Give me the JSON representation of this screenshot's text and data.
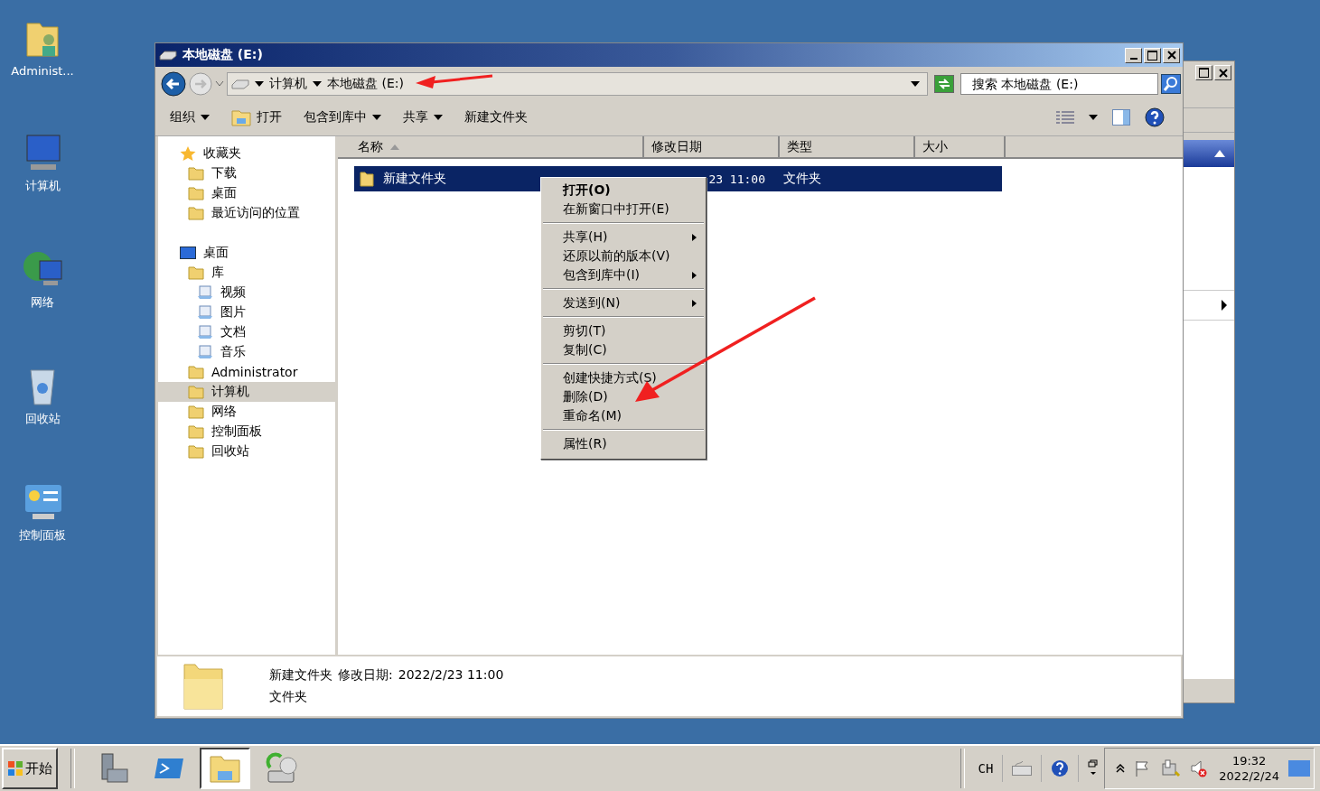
{
  "desktop_icons": [
    {
      "label": "Administ..."
    },
    {
      "label": "计算机"
    },
    {
      "label": "网络"
    },
    {
      "label": "回收站"
    },
    {
      "label": "控制面板"
    }
  ],
  "window": {
    "title": "本地磁盘 (E:)",
    "address": [
      "计算机",
      "本地磁盘 (E:)"
    ],
    "search": {
      "placeholder": "搜索 本地磁盘 (E:)"
    },
    "toolbar": [
      {
        "label": "组织",
        "dropdown": true,
        "icon": false
      },
      {
        "label": "打开",
        "dropdown": false,
        "icon": true
      },
      {
        "label": "包含到库中",
        "dropdown": true,
        "icon": false
      },
      {
        "label": "共享",
        "dropdown": true,
        "icon": false
      },
      {
        "label": "新建文件夹",
        "dropdown": false,
        "icon": false
      }
    ],
    "nav": [
      {
        "label": "收藏夹",
        "selected": false,
        "children": [
          {
            "label": "下载",
            "selected": false
          },
          {
            "label": "桌面",
            "selected": false
          },
          {
            "label": "最近访问的位置",
            "selected": false
          }
        ]
      },
      {
        "label": "桌面",
        "selected": false,
        "children": [
          {
            "label": "库",
            "selected": false,
            "children": [
              {
                "label": "视频",
                "selected": false
              },
              {
                "label": "图片",
                "selected": false
              },
              {
                "label": "文档",
                "selected": false
              },
              {
                "label": "音乐",
                "selected": false
              }
            ]
          },
          {
            "label": "Administrator",
            "selected": false
          },
          {
            "label": "计算机",
            "selected": true
          },
          {
            "label": "网络",
            "selected": false
          },
          {
            "label": "控制面板",
            "selected": false
          },
          {
            "label": "回收站",
            "selected": false
          }
        ]
      }
    ],
    "columns": [
      {
        "label": "名称",
        "sorted": true
      },
      {
        "label": "修改日期",
        "sorted": false
      },
      {
        "label": "类型",
        "sorted": false
      },
      {
        "label": "大小",
        "sorted": false
      }
    ],
    "files": [
      {
        "name": "新建文件夹",
        "date": "23 11:00",
        "type": "文件夹",
        "selected": true
      }
    ],
    "context_menu": [
      [
        {
          "label": "打开(O)",
          "bold": true,
          "submenu": false
        },
        {
          "label": "在新窗口中打开(E)",
          "bold": false,
          "submenu": false
        }
      ],
      [
        {
          "label": "共享(H)",
          "bold": false,
          "submenu": true
        },
        {
          "label": "还原以前的版本(V)",
          "bold": false,
          "submenu": false
        },
        {
          "label": "包含到库中(I)",
          "bold": false,
          "submenu": true
        }
      ],
      [
        {
          "label": "发送到(N)",
          "bold": false,
          "submenu": true
        }
      ],
      [
        {
          "label": "剪切(T)",
          "bold": false,
          "submenu": false
        },
        {
          "label": "复制(C)",
          "bold": false,
          "submenu": false
        }
      ],
      [
        {
          "label": "创建快捷方式(S)",
          "bold": false,
          "submenu": false
        },
        {
          "label": "删除(D)",
          "bold": false,
          "submenu": false
        },
        {
          "label": "重命名(M)",
          "bold": false,
          "submenu": false
        }
      ],
      [
        {
          "label": "属性(R)",
          "bold": false,
          "submenu": false
        }
      ]
    ],
    "details": {
      "name": "新建文件夹",
      "modified_label": "修改日期:",
      "modified": "2022/2/23 11:00",
      "type": "文件夹"
    }
  },
  "taskbar": {
    "start": "开始",
    "apps": [
      {
        "selected": false
      },
      {
        "selected": false
      },
      {
        "selected": true
      },
      {
        "selected": false
      }
    ],
    "lang": "CH",
    "time": "19:32",
    "date": "2022/2/24"
  }
}
